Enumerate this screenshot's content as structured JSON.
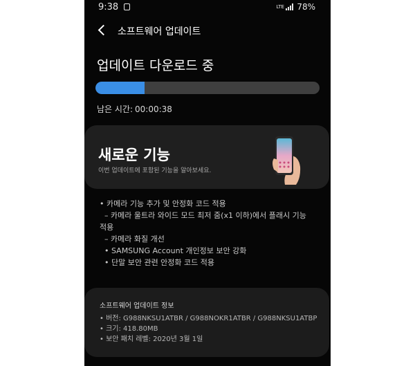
{
  "status_bar": {
    "time": "9:38",
    "network": "LTE",
    "battery": "78%"
  },
  "header": {
    "back_icon": "chevron-left-icon",
    "title": "소프트웨어 업데이트"
  },
  "download": {
    "title": "업데이트 다운로드 중",
    "progress_percent": 22,
    "remaining_label": "남은 시간:",
    "remaining_time": "00:00:38",
    "progress_color": "#3a8ee6"
  },
  "new_features": {
    "title": "새로운 기능",
    "description": "이번 업데이트에 포함된 기능을 알아보세요.",
    "illustration_icon": "phone-in-hand-icon"
  },
  "release_notes": [
    "• 카메라 기능 추가 및 안정화 코드 적용",
    "  – 카메라 울트라 와이드 모드 최저 줌(x1 이하)에서 플래시 기능",
    "적용",
    "  – 카메라 화질 개선",
    "  • SAMSUNG Account 개인정보 보안 강화",
    "  • 단말 보안 관련 안정화 코드 적용"
  ],
  "software_info": {
    "title": "소프트웨어 업데이트 정보",
    "items": [
      "• 버전: G988NKSU1ATBR / G988NOKR1ATBR / G988NKSU1ATBP",
      "• 크기: 418.80MB",
      "• 보안 패치 레벨: 2020년 3월 1일"
    ]
  }
}
